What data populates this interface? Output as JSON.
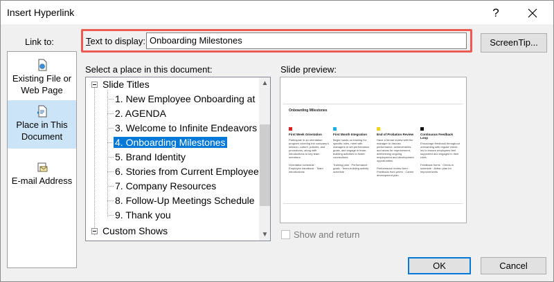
{
  "window": {
    "title": "Insert Hyperlink",
    "help_label": "?"
  },
  "link_to": {
    "label": "Link to:",
    "items": [
      {
        "label1": "Existing File or",
        "label2": "Web Page",
        "icon": "file-globe-icon",
        "selected": false
      },
      {
        "label1": "Place in This",
        "label2": "Document",
        "icon": "document-place-icon",
        "selected": true
      },
      {
        "label1": "E-mail Address",
        "label2": "",
        "icon": "email-icon",
        "selected": false
      }
    ]
  },
  "text_to_display": {
    "label_prefix": "T",
    "label_rest": "ext to display:",
    "value": "Onboarding Milestones"
  },
  "screentip": {
    "label": "ScreenTip..."
  },
  "place": {
    "label": "Select a place in this document:",
    "root": "Slide Titles",
    "items": [
      "1. New Employee Onboarding at",
      "2. AGENDA",
      "3. Welcome to Infinite Endeavors",
      "4. Onboarding Milestones",
      "5. Brand Identity",
      "6. Stories from Current Employee",
      "7. Company Resources",
      "8. Follow-Up Meetings Schedule",
      "9. Thank you"
    ],
    "selected_index": 3,
    "next_root_partial": "Custom Shows"
  },
  "preview": {
    "label": "Slide preview:",
    "slide_title": "Onboarding Milestones",
    "columns": [
      {
        "color": "#e02020",
        "heading": "First Week Orientation",
        "body": "Participate in an orientation program covering the company's mission, culture, policies, and procedures, along with introductions to key team members.",
        "list": "Orientation schedule · Employee handbook · Team introductions"
      },
      {
        "color": "#1ab0e8",
        "heading": "First Month Integration",
        "body": "Begin hands-on training for specific roles, meet with managers to set performance goals, and engage in team-building activities to foster connections.",
        "list": "Training plan · Performance goals · Team-building activity schedule"
      },
      {
        "color": "#f2d21a",
        "heading": "End of Probation Review",
        "body": "Have a formal review with the manager to discuss performance, achievements, and areas for improvement, determining ongoing employment and development opportunities.",
        "list": "Performance review form · Feedback from peers · Career development plan"
      },
      {
        "color": "#111111",
        "heading": "Continuous Feedback Loop",
        "body": "Encourage feedback throughout onboarding with regular check-ins to ensure employees feel supported and engaged in their roles.",
        "list": "Feedback forms · Check-in schedule · Action plan for improvements"
      }
    ]
  },
  "show_and_return": {
    "label": "Show and return",
    "checked": false,
    "enabled": false
  },
  "buttons": {
    "ok": "OK",
    "cancel": "Cancel"
  }
}
